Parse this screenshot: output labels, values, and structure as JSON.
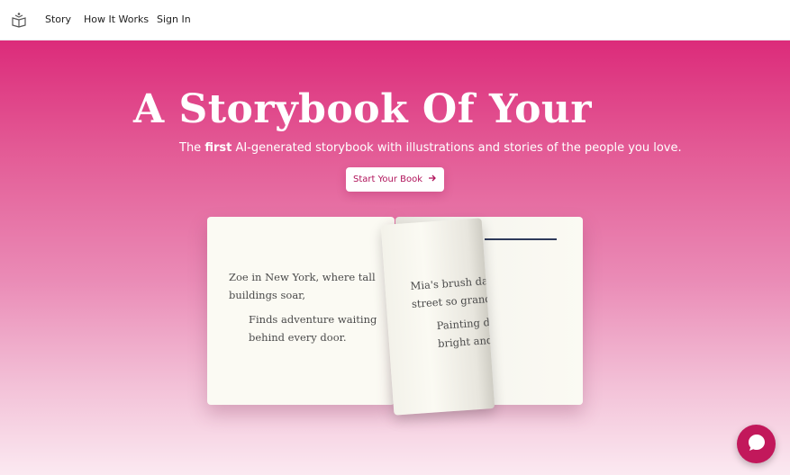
{
  "nav": {
    "logo": "book-logo-icon",
    "links": [
      "Story",
      "How It Works",
      "Sign In"
    ]
  },
  "hero": {
    "headline": "A Storybook Of Your",
    "subtitle_pre": "The ",
    "subtitle_bold": "first",
    "subtitle_post": " AI-generated storybook with illustrations and stories of the people you love.",
    "cta_label": "Start Your Book",
    "cta_icon": "arrow-right-icon"
  },
  "book": {
    "left_line1": "Zoe in New York, where tall buildings soar,",
    "left_line2": "Finds adventure waiting behind every door.",
    "right_line1": "Mia's brush danc",
    "right_line1b": "street so grand,",
    "right_line2": "Painting dre",
    "right_line2b": "bright and b"
  },
  "chat": {
    "icon": "chat-bubble-icon"
  },
  "colors": {
    "accent": "#dc2b7a",
    "cta_text": "#b0125a",
    "chat_bg": "#c2185b"
  }
}
